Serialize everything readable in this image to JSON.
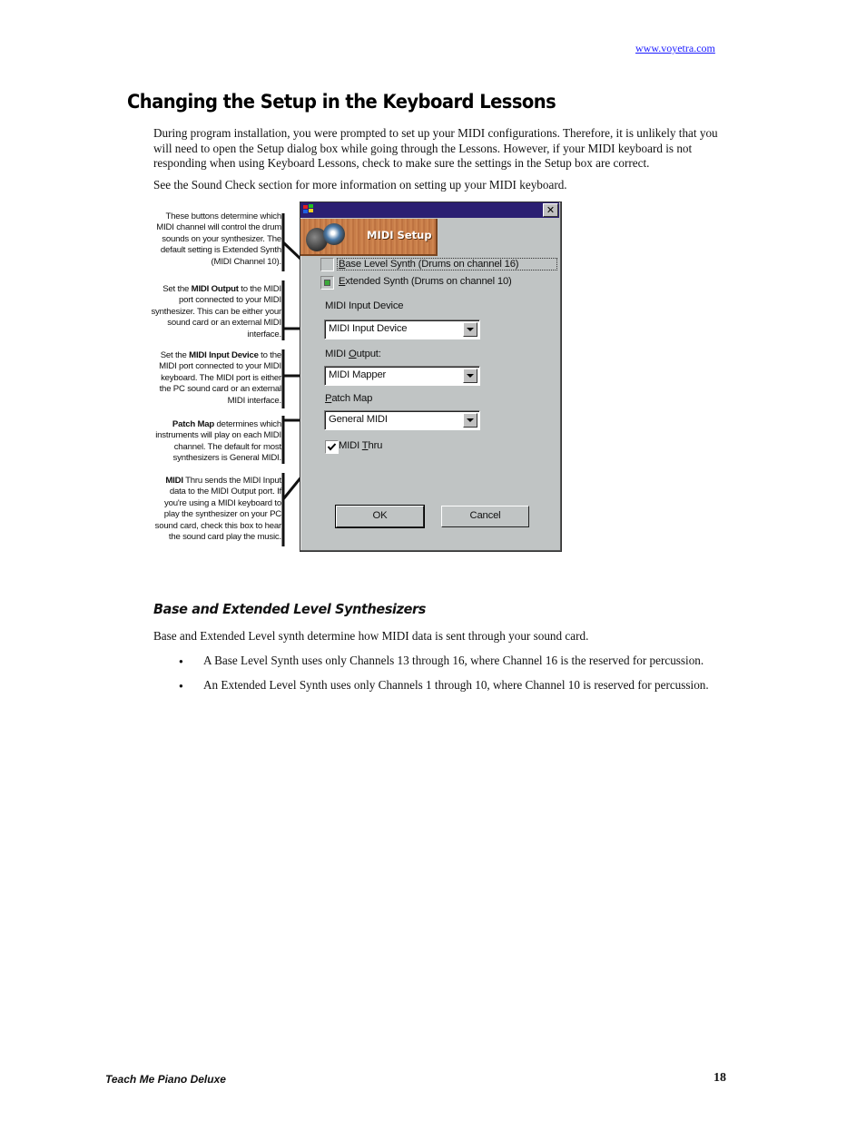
{
  "header": {
    "link": "www.voyetra.com"
  },
  "title": "Changing the Setup in the Keyboard Lessons",
  "intro": [
    "During program installation, you were prompted to set up your MIDI configurations. Therefore, it is unlikely that you will need to open the Setup dialog box while going through the Lessons. However, if your MIDI keyboard is not responding when using Keyboard Lessons, check to make sure the settings in the Setup box are correct.",
    "See the Sound Check section for more information on setting up your MIDI keyboard."
  ],
  "callouts": [
    {
      "bold": "",
      "text": "These buttons determine which MIDI channel will control the drum sounds on your synthesizer. The default setting is Extended Synth (MIDI Channel 10)."
    },
    {
      "pre": "Set the ",
      "bold": "MIDI Output",
      "text": " to the MIDI port connected to your MIDI synthesizer. This can be either your sound card or an external MIDI interface."
    },
    {
      "pre": "Set the ",
      "bold": "MIDI Input Device",
      "text": " to the MIDI port connected to your MIDI keyboard. The MIDI port is either the PC sound card or an external MIDI interface."
    },
    {
      "pre": "",
      "bold": "Patch Map",
      "text": " determines which instruments will play on each MIDI channel. The default for most synthesizers is General MIDI."
    },
    {
      "pre": "",
      "bold": "MIDI",
      "text": " Thru sends the MIDI Input data to the MIDI Output port. If you're using a MIDI keyboard to play the synthesizer on your PC sound card, check this box to hear the sound card play the music."
    }
  ],
  "dialog": {
    "close_label": "✕",
    "banner_title": "MIDI Setup",
    "radio_base": {
      "accel": "B",
      "rest": "ase Level Synth (Drums on channel 16)",
      "selected": false
    },
    "radio_extended": {
      "accel": "E",
      "rest": "xtended Synth (Drums on channel 10)",
      "selected": true
    },
    "input_label": "MIDI Input Device",
    "input_value": "MIDI Input Device",
    "output_label_pre": "MIDI ",
    "output_label_accel": "O",
    "output_label_rest": "utput:",
    "output_value": "MIDI Mapper",
    "patch_label_accel": "P",
    "patch_label_rest": "atch Map",
    "patch_value": "General MIDI",
    "thru_pre": "MIDI ",
    "thru_accel": "T",
    "thru_rest": "hru",
    "thru_checked": true,
    "ok_label": "OK",
    "cancel_label": "Cancel",
    "titlebar_color": "#2b1f72"
  },
  "section2": {
    "heading": "Base and Extended Level Synthesizers",
    "intro": "Base and Extended Level synth determine how MIDI data is sent through your sound card.",
    "bullets": [
      "A Base Level Synth uses only Channels 13 through 16, where Channel 16 is the reserved for percussion.",
      "An Extended Level Synth uses only Channels 1 through 10, where Channel 10 is reserved for percussion."
    ]
  },
  "footer": {
    "title": "Teach Me Piano Deluxe",
    "page": "18"
  }
}
